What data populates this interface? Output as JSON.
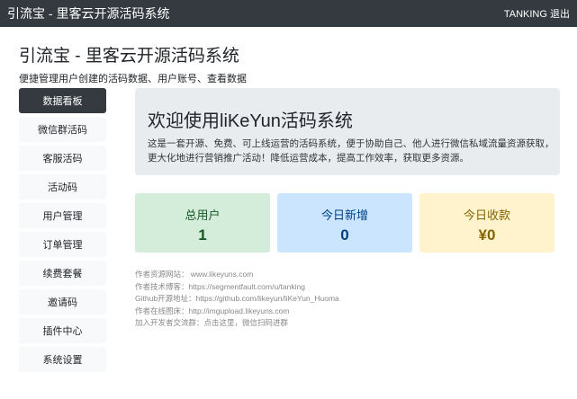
{
  "topbar": {
    "title": "引流宝 - 里客云开源活码系统",
    "user": "TANKING 退出"
  },
  "header": {
    "title": "引流宝 - 里客云开源活码系统",
    "subtitle": "便捷管理用户创建的活码数据、用户账号、查看数据"
  },
  "sidebar": {
    "items": [
      {
        "label": "数据看板"
      },
      {
        "label": "微信群活码"
      },
      {
        "label": "客服活码"
      },
      {
        "label": "活动码"
      },
      {
        "label": "用户管理"
      },
      {
        "label": "订单管理"
      },
      {
        "label": "续费套餐"
      },
      {
        "label": "邀请码"
      },
      {
        "label": "插件中心"
      },
      {
        "label": "系统设置"
      }
    ]
  },
  "welcome": {
    "title": "欢迎使用liKeYun活码系统",
    "text": "这是一套开源、免费、可上线运营的活码系统，便于协助自己、他人进行微信私域流量资源获取，更大化地进行营销推广活动！降低运营成本，提高工作效率，获取更多资源。"
  },
  "stats": [
    {
      "label": "总用户",
      "value": "1",
      "bg": "#d4edda",
      "color": "#155724"
    },
    {
      "label": "今日新增",
      "value": "0",
      "bg": "#cce5ff",
      "color": "#004085"
    },
    {
      "label": "今日收款",
      "value": "¥0",
      "bg": "#fff3cd",
      "color": "#856404"
    }
  ],
  "links": [
    "作者资源网站： www.likeyuns.com",
    "作者技术博客：https://segmentfault.com/u/tanking",
    "Github开源地址：https://github.com/likeyun/liKeYun_Huoma",
    "作者在线图床：http://imgupload.likeyuns.com",
    "加入开发者交流群：点击这里，微信扫码进群"
  ]
}
